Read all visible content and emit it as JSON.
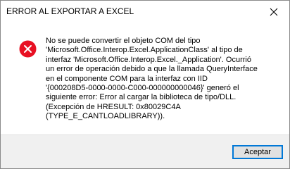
{
  "window": {
    "title": "ERROR AL EXPORTAR A EXCEL",
    "close_icon": "close-x-icon"
  },
  "dialog": {
    "icon": "error-icon",
    "icon_color": "#e81123",
    "message_lines": [
      "No se puede convertir el objeto COM del tipo",
      "'Microsoft.Office.Interop.Excel.ApplicationClass' al tipo de",
      "interfaz 'Microsoft.Office.Interop.Excel._Application'. Ocurrió",
      "un error de operación debido a que la llamada QueryInterface",
      "en el componente COM para la interfaz con IID",
      "'{000208D5-0000-0000-C000-000000000046}' generó el",
      "siguiente error: Error al cargar la biblioteca de tipo/DLL.",
      "(Excepción de HRESULT: 0x80029C4A",
      "(TYPE_E_CANTLOADLIBRARY))."
    ]
  },
  "footer": {
    "accept_label": "Aceptar",
    "accent_color": "#0078d7"
  }
}
